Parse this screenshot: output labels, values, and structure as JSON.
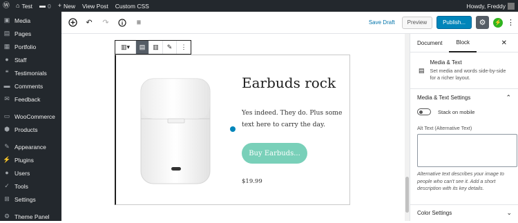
{
  "admin_bar": {
    "site_name": "Test",
    "comments_count": "0",
    "new_label": "New",
    "view_post_label": "View Post",
    "custom_css_label": "Custom CSS",
    "greeting": "Howdy, Freddy"
  },
  "sidebar": {
    "items": [
      {
        "label": "Media",
        "icon": "media-icon"
      },
      {
        "label": "Pages",
        "icon": "pages-icon"
      },
      {
        "label": "Portfolio",
        "icon": "portfolio-icon"
      },
      {
        "label": "Staff",
        "icon": "staff-icon"
      },
      {
        "label": "Testimonials",
        "icon": "testimonials-icon"
      },
      {
        "label": "Comments",
        "icon": "comments-icon"
      },
      {
        "label": "Feedback",
        "icon": "feedback-icon"
      },
      {
        "label": "WooCommerce",
        "icon": "woocommerce-icon"
      },
      {
        "label": "Products",
        "icon": "products-icon"
      },
      {
        "label": "Appearance",
        "icon": "appearance-icon"
      },
      {
        "label": "Plugins",
        "icon": "plugins-icon"
      },
      {
        "label": "Users",
        "icon": "users-icon"
      },
      {
        "label": "Tools",
        "icon": "tools-icon"
      },
      {
        "label": "Settings",
        "icon": "settings-icon"
      },
      {
        "label": "Theme Panel",
        "icon": "theme-panel-icon"
      }
    ]
  },
  "editor_toolbar": {
    "save_draft": "Save Draft",
    "preview": "Preview",
    "publish": "Publish..."
  },
  "block": {
    "title": "Earbuds rock",
    "body": "Yes indeed. They do. Plus some text here to carry the day.",
    "button": "Buy Earbuds...",
    "price": "$19.99"
  },
  "panel": {
    "tabs": [
      "Document",
      "Block"
    ],
    "active_tab": "Block",
    "block_name": "Media & Text",
    "block_description": "Set media and words side-by-side for a richer layout.",
    "settings_heading": "Media & Text Settings",
    "stack_label": "Stack on mobile",
    "stack_on_mobile": false,
    "alt_label": "Alt Text (Alternative Text)",
    "alt_value": "",
    "alt_help": "Alternative text describes your image to people who can't see it. Add a short description with its key details.",
    "color_heading": "Color Settings"
  },
  "colors": {
    "admin_bg": "#23282d",
    "publish_bg": "#0085ba",
    "button_bg": "#79d0b9",
    "jetpack_green": "#2fb41f"
  }
}
